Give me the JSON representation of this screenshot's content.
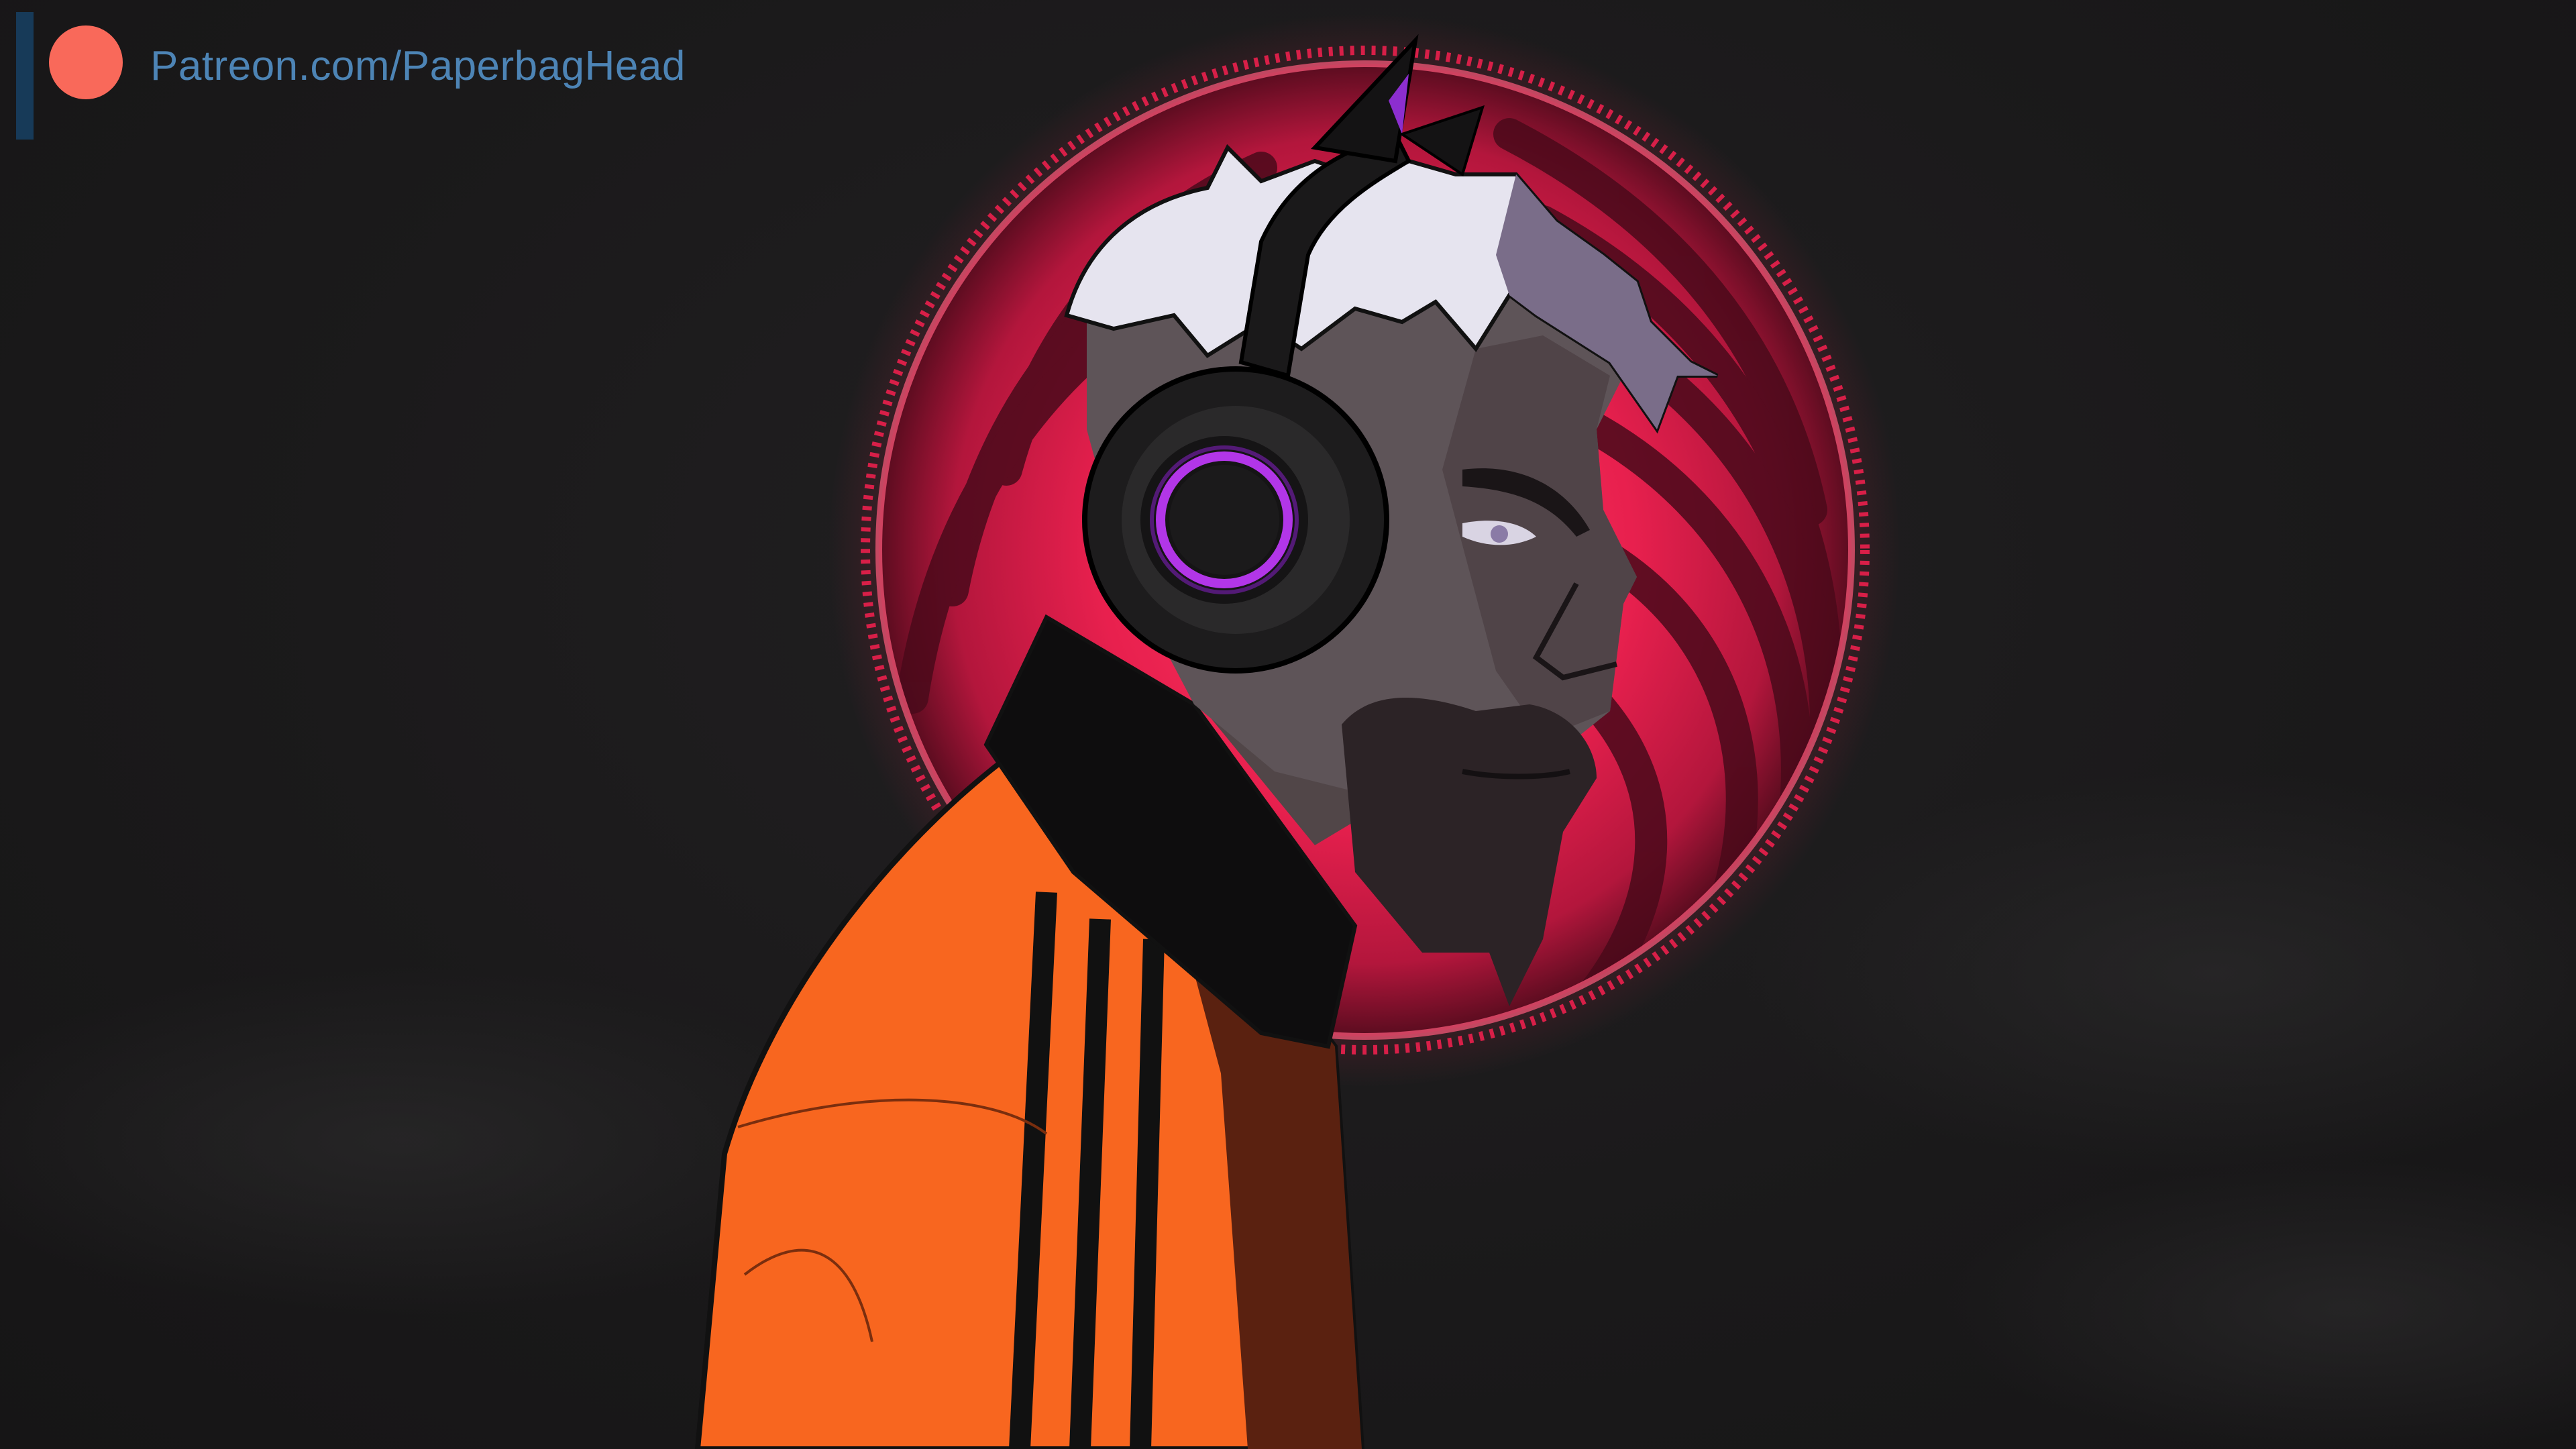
{
  "watermark": {
    "text": "Patreon.com/PaperbagHead",
    "logo_icon": "patreon-logo-icon",
    "colors": {
      "bar": "#173a58",
      "dot": "#f9695a",
      "text": "#4d84b5"
    }
  },
  "artwork": {
    "subject": "illustrated-man-with-headphones",
    "colors": {
      "background": "#1c1b1c",
      "halo": "#e8204e",
      "jacket": "#f8661f",
      "hair": "#e6e4ef",
      "headphone_ring": "#b236e8"
    }
  }
}
